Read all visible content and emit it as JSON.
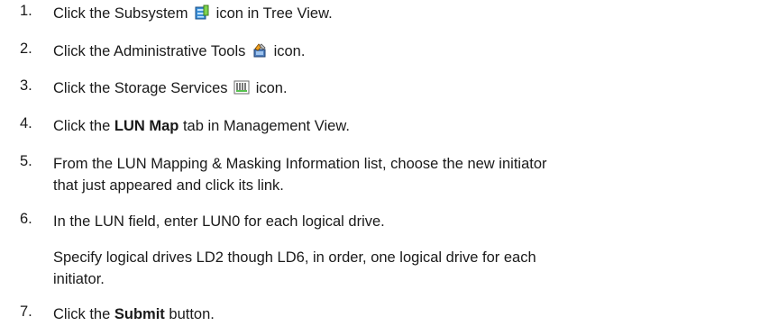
{
  "steps": [
    {
      "num": "1.",
      "pre": "Click the Subsystem",
      "icon": "subsystem-icon",
      "post": "icon in Tree View."
    },
    {
      "num": "2.",
      "pre": "Click the Administrative Tools",
      "icon": "administrative-tools-icon",
      "post": "icon."
    },
    {
      "num": "3.",
      "pre": "Click the Storage Services",
      "icon": "storage-services-icon",
      "post": "icon."
    },
    {
      "num": "4.",
      "pre": "Click the",
      "bold": "LUN Map",
      "post": "tab in Management View."
    },
    {
      "num": "5.",
      "line1": "From the LUN Mapping & Masking Information list, choose the new initiator",
      "line2": "that just appeared and click its link."
    },
    {
      "num": "6.",
      "text": "In the LUN field, enter LUN0 for each logical drive.",
      "note1": "Specify logical drives LD2 though LD6, in order, one logical drive for each",
      "note2": "initiator."
    },
    {
      "num": "7.",
      "pre": "Click the",
      "bold": "Submit",
      "post": "button."
    }
  ]
}
